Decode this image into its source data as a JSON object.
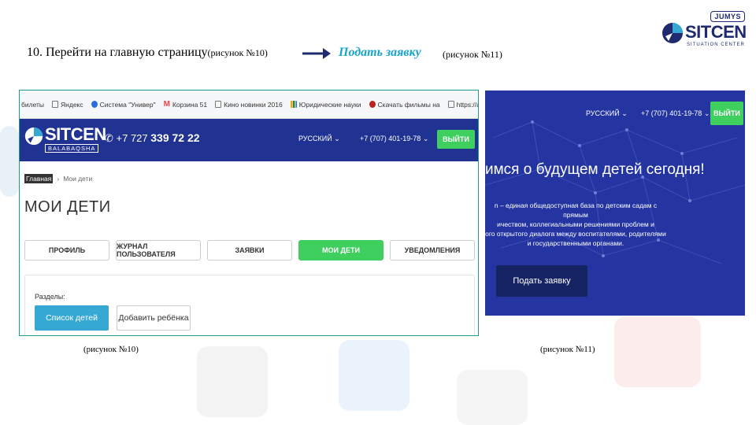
{
  "logo": {
    "jumys": "JUMYS",
    "brand": "SITCEN",
    "sub": "SITUATION CENTER"
  },
  "instruction": {
    "step": "10. Перейти на главную страницу",
    "ref1": "(рисунок №10)",
    "link": "Подать заявку",
    "ref2": "(рисунок №11)"
  },
  "shot1": {
    "bookmarks": [
      "билеты",
      "Яндекс",
      "Система \"Универ\"",
      "Корзина 51",
      "Кино новинки 2016",
      "Юридические науки",
      "Скачать фильмы на",
      "https://alm.dmed.kz"
    ],
    "brand": "SITCEN",
    "brand_sub": "BALABAQSHA",
    "phone_prefix": "+7 727",
    "phone_main": "339 72 22",
    "lang": "РУССКИЙ",
    "phone2": "+7 (707) 401-19-78",
    "login": "ВЫЙТИ",
    "crumb_home": "Главная",
    "crumb_current": "Мои дети",
    "title": "МОИ ДЕТИ",
    "tabs": [
      "ПРОФИЛЬ",
      "ЖУРНАЛ ПОЛЬЗОВАТЕЛЯ",
      "ЗАЯВКИ",
      "МОИ ДЕТИ",
      "УВЕДОМЛЕНИЯ"
    ],
    "section_label": "Разделы:",
    "btn_list": "Список детей",
    "btn_add": "Добавить ребёнка"
  },
  "shot2": {
    "lang": "РУССКИЙ",
    "phone2": "+7 (707) 401-19-78",
    "login": "ВЫЙТИ",
    "headline": "имся о будущем детей сегодня!",
    "desc": [
      "n – единая общедоступная база по детским садам с прямым",
      "ичеством, коллегиальными решениями проблем и",
      "ого открытого диалога между воспитателями, родителями",
      "и государственными органами."
    ],
    "apply": "Подать заявку"
  },
  "captions": {
    "c1": "(рисунок №10)",
    "c2": "(рисунок №11)"
  },
  "colors": {
    "navy": "#213392",
    "green": "#3fcf5f",
    "blue": "#35a9d4",
    "accent_link": "#17a3cf"
  }
}
